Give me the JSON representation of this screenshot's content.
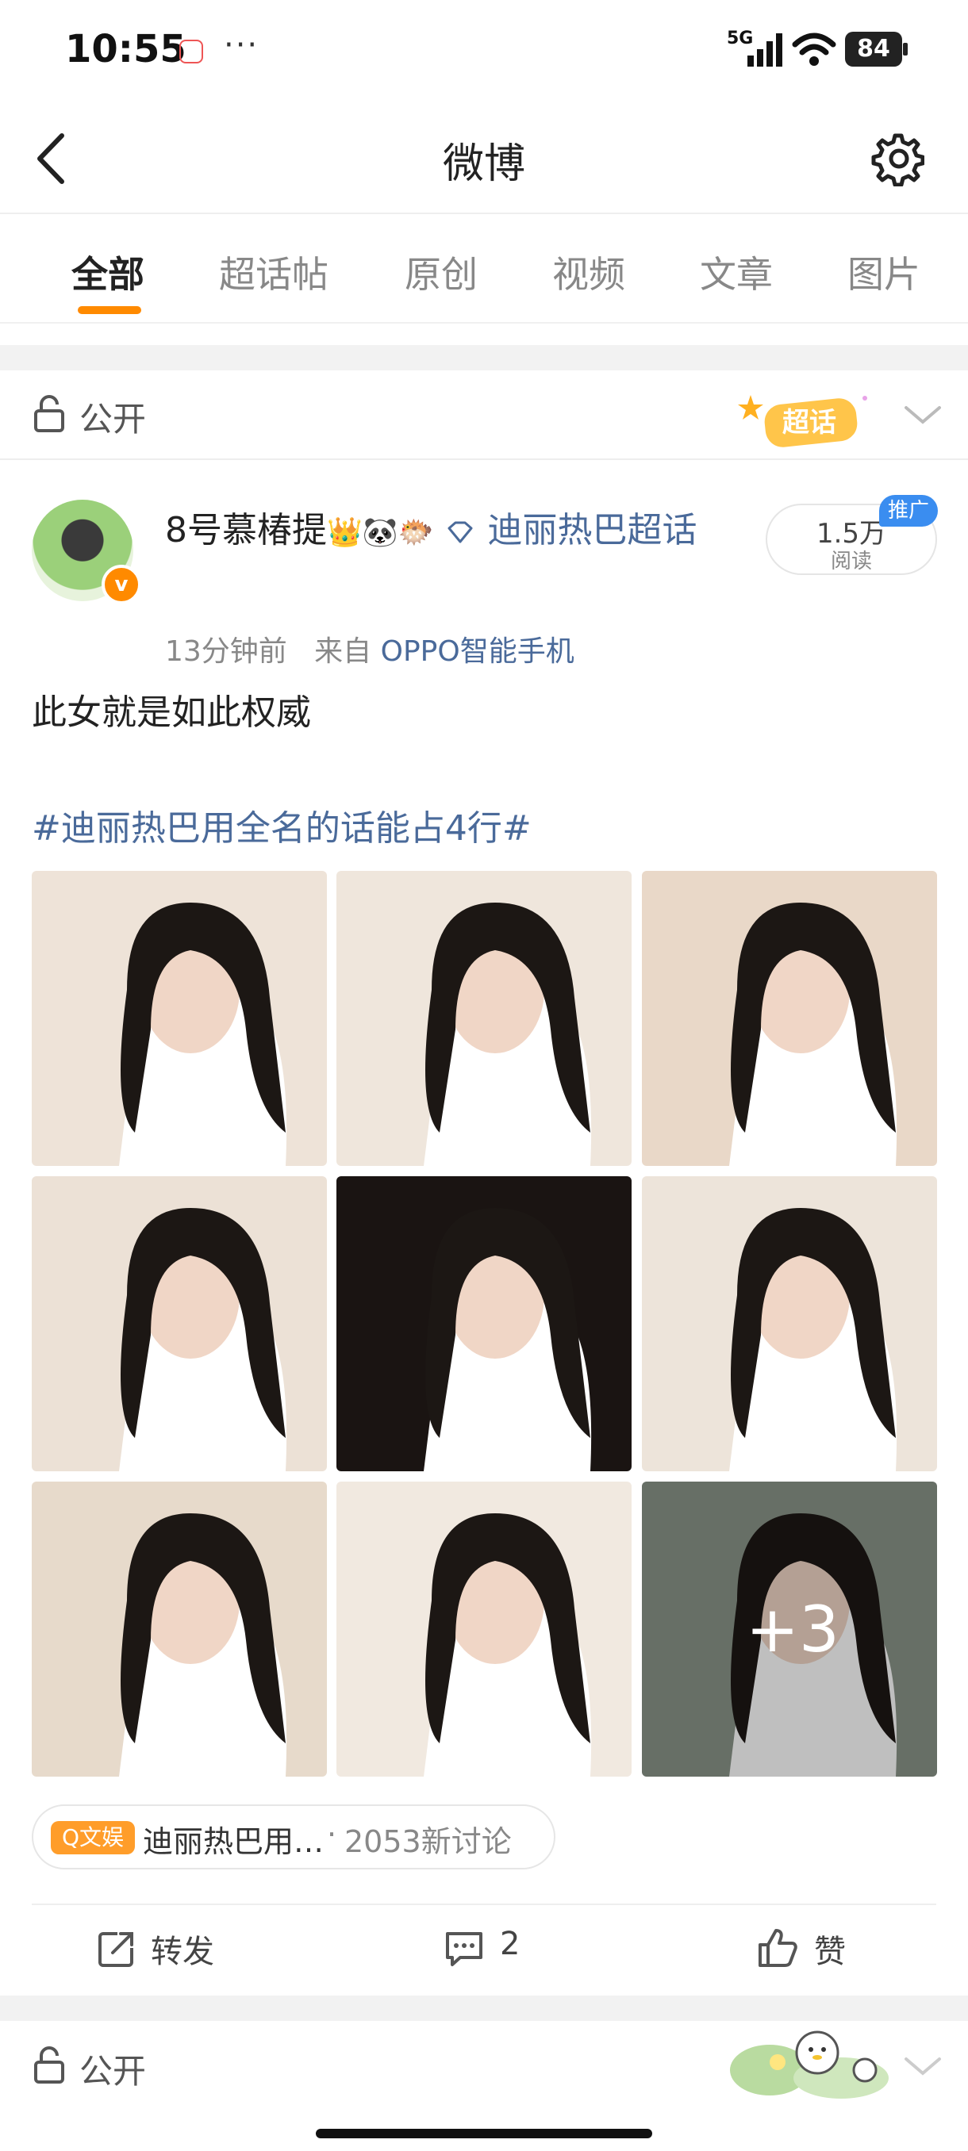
{
  "status_bar": {
    "time": "10:55",
    "dots": "···",
    "network": "5G",
    "battery": "84"
  },
  "header": {
    "title": "微博",
    "back_icon": "chevron-left-icon",
    "settings_icon": "gear-icon"
  },
  "tabs": [
    {
      "label": "全部",
      "active": true
    },
    {
      "label": "超话帖",
      "active": false
    },
    {
      "label": "原创",
      "active": false
    },
    {
      "label": "视频",
      "active": false
    },
    {
      "label": "文章",
      "active": false
    },
    {
      "label": "图片",
      "active": false
    }
  ],
  "post": {
    "visibility": "公开",
    "badge": "超话",
    "user": {
      "name": "8号慕椿提",
      "emoji_badges": "👑🐼🐡",
      "topic": "迪丽热巴超话",
      "verified_mark": "v"
    },
    "read_count": "1.5万",
    "read_label": "阅读",
    "promo_label": "推广",
    "time_ago": "13分钟前",
    "source_prefix": "来自",
    "source": "OPPO智能手机",
    "text": "此女就是如此权威",
    "hashtag": "#迪丽热巴用全名的话能占4行#",
    "photo_count_total": 12,
    "more_photos": "+3",
    "topic_pill": {
      "tag": "Q文娱",
      "name": "迪丽热巴用…",
      "separator": "·",
      "count": "2053新讨论"
    },
    "actions": {
      "repost": "转发",
      "comment_count": "2",
      "like": "赞"
    }
  },
  "next_post": {
    "visibility": "公开"
  },
  "colors": {
    "accent": "#ff8a00",
    "link": "#4a6a9a",
    "promo": "#3a8df0",
    "separator": "#f2f2f2"
  }
}
